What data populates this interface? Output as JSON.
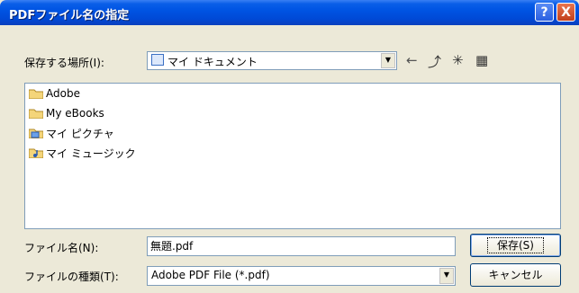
{
  "window": {
    "title": "PDFファイル名の指定",
    "help_label": "?",
    "close_label": "X"
  },
  "location": {
    "label": "保存する場所(I):",
    "value": "マイ ドキュメント",
    "toolbar": [
      "back-icon",
      "up-folder-icon",
      "new-folder-icon",
      "view-menu-icon"
    ]
  },
  "files": [
    {
      "name": "Adobe",
      "icon": "folder-icon"
    },
    {
      "name": "My eBooks",
      "icon": "folder-icon"
    },
    {
      "name": "マイ ピクチャ",
      "icon": "pictures-folder-icon"
    },
    {
      "name": "マイ ミュージック",
      "icon": "music-folder-icon"
    }
  ],
  "filename": {
    "label": "ファイル名(N):",
    "value": "無題.pdf"
  },
  "filetype": {
    "label": "ファイルの種類(T):",
    "value": "Adobe PDF File (*.pdf)"
  },
  "buttons": {
    "save": "保存(S)",
    "cancel": "キャンセル"
  },
  "colors": {
    "titlebar": "#0054e3",
    "dialog_bg": "#ece9d8",
    "border": "#7f9db9"
  }
}
